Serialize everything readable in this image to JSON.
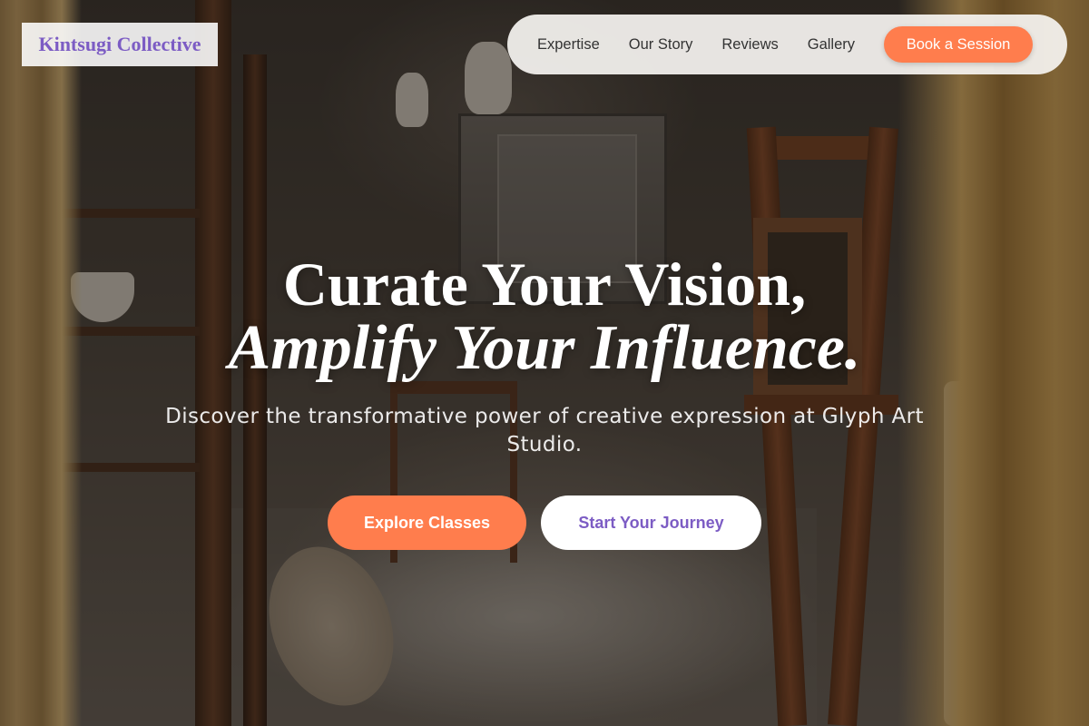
{
  "brand": {
    "name": "Kintsugi Collective"
  },
  "nav": {
    "links": [
      "Expertise",
      "Our Story",
      "Reviews",
      "Gallery"
    ],
    "cta": "Book a Session"
  },
  "hero": {
    "headline_line1": "Curate Your Vision,",
    "headline_line2": "Amplify Your Influence.",
    "subtitle": "Discover the transformative power of creative expression at Glyph Art Studio.",
    "primary_button": "Explore Classes",
    "secondary_button": "Start Your Journey"
  },
  "colors": {
    "accent": "#ff7d4d",
    "brand_purple": "#7c5cc4"
  }
}
